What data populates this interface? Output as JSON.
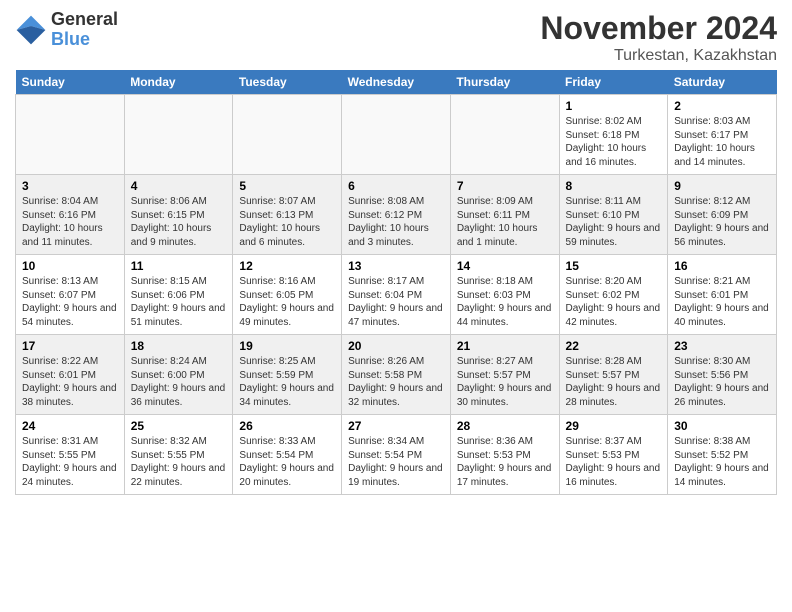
{
  "header": {
    "logo_text_general": "General",
    "logo_text_blue": "Blue",
    "month_title": "November 2024",
    "location": "Turkestan, Kazakhstan"
  },
  "weekdays": [
    "Sunday",
    "Monday",
    "Tuesday",
    "Wednesday",
    "Thursday",
    "Friday",
    "Saturday"
  ],
  "weeks": [
    [
      {
        "day": "",
        "sunrise": "",
        "sunset": "",
        "daylight": ""
      },
      {
        "day": "",
        "sunrise": "",
        "sunset": "",
        "daylight": ""
      },
      {
        "day": "",
        "sunrise": "",
        "sunset": "",
        "daylight": ""
      },
      {
        "day": "",
        "sunrise": "",
        "sunset": "",
        "daylight": ""
      },
      {
        "day": "",
        "sunrise": "",
        "sunset": "",
        "daylight": ""
      },
      {
        "day": "1",
        "sunrise": "Sunrise: 8:02 AM",
        "sunset": "Sunset: 6:18 PM",
        "daylight": "Daylight: 10 hours and 16 minutes."
      },
      {
        "day": "2",
        "sunrise": "Sunrise: 8:03 AM",
        "sunset": "Sunset: 6:17 PM",
        "daylight": "Daylight: 10 hours and 14 minutes."
      }
    ],
    [
      {
        "day": "3",
        "sunrise": "Sunrise: 8:04 AM",
        "sunset": "Sunset: 6:16 PM",
        "daylight": "Daylight: 10 hours and 11 minutes."
      },
      {
        "day": "4",
        "sunrise": "Sunrise: 8:06 AM",
        "sunset": "Sunset: 6:15 PM",
        "daylight": "Daylight: 10 hours and 9 minutes."
      },
      {
        "day": "5",
        "sunrise": "Sunrise: 8:07 AM",
        "sunset": "Sunset: 6:13 PM",
        "daylight": "Daylight: 10 hours and 6 minutes."
      },
      {
        "day": "6",
        "sunrise": "Sunrise: 8:08 AM",
        "sunset": "Sunset: 6:12 PM",
        "daylight": "Daylight: 10 hours and 3 minutes."
      },
      {
        "day": "7",
        "sunrise": "Sunrise: 8:09 AM",
        "sunset": "Sunset: 6:11 PM",
        "daylight": "Daylight: 10 hours and 1 minute."
      },
      {
        "day": "8",
        "sunrise": "Sunrise: 8:11 AM",
        "sunset": "Sunset: 6:10 PM",
        "daylight": "Daylight: 9 hours and 59 minutes."
      },
      {
        "day": "9",
        "sunrise": "Sunrise: 8:12 AM",
        "sunset": "Sunset: 6:09 PM",
        "daylight": "Daylight: 9 hours and 56 minutes."
      }
    ],
    [
      {
        "day": "10",
        "sunrise": "Sunrise: 8:13 AM",
        "sunset": "Sunset: 6:07 PM",
        "daylight": "Daylight: 9 hours and 54 minutes."
      },
      {
        "day": "11",
        "sunrise": "Sunrise: 8:15 AM",
        "sunset": "Sunset: 6:06 PM",
        "daylight": "Daylight: 9 hours and 51 minutes."
      },
      {
        "day": "12",
        "sunrise": "Sunrise: 8:16 AM",
        "sunset": "Sunset: 6:05 PM",
        "daylight": "Daylight: 9 hours and 49 minutes."
      },
      {
        "day": "13",
        "sunrise": "Sunrise: 8:17 AM",
        "sunset": "Sunset: 6:04 PM",
        "daylight": "Daylight: 9 hours and 47 minutes."
      },
      {
        "day": "14",
        "sunrise": "Sunrise: 8:18 AM",
        "sunset": "Sunset: 6:03 PM",
        "daylight": "Daylight: 9 hours and 44 minutes."
      },
      {
        "day": "15",
        "sunrise": "Sunrise: 8:20 AM",
        "sunset": "Sunset: 6:02 PM",
        "daylight": "Daylight: 9 hours and 42 minutes."
      },
      {
        "day": "16",
        "sunrise": "Sunrise: 8:21 AM",
        "sunset": "Sunset: 6:01 PM",
        "daylight": "Daylight: 9 hours and 40 minutes."
      }
    ],
    [
      {
        "day": "17",
        "sunrise": "Sunrise: 8:22 AM",
        "sunset": "Sunset: 6:01 PM",
        "daylight": "Daylight: 9 hours and 38 minutes."
      },
      {
        "day": "18",
        "sunrise": "Sunrise: 8:24 AM",
        "sunset": "Sunset: 6:00 PM",
        "daylight": "Daylight: 9 hours and 36 minutes."
      },
      {
        "day": "19",
        "sunrise": "Sunrise: 8:25 AM",
        "sunset": "Sunset: 5:59 PM",
        "daylight": "Daylight: 9 hours and 34 minutes."
      },
      {
        "day": "20",
        "sunrise": "Sunrise: 8:26 AM",
        "sunset": "Sunset: 5:58 PM",
        "daylight": "Daylight: 9 hours and 32 minutes."
      },
      {
        "day": "21",
        "sunrise": "Sunrise: 8:27 AM",
        "sunset": "Sunset: 5:57 PM",
        "daylight": "Daylight: 9 hours and 30 minutes."
      },
      {
        "day": "22",
        "sunrise": "Sunrise: 8:28 AM",
        "sunset": "Sunset: 5:57 PM",
        "daylight": "Daylight: 9 hours and 28 minutes."
      },
      {
        "day": "23",
        "sunrise": "Sunrise: 8:30 AM",
        "sunset": "Sunset: 5:56 PM",
        "daylight": "Daylight: 9 hours and 26 minutes."
      }
    ],
    [
      {
        "day": "24",
        "sunrise": "Sunrise: 8:31 AM",
        "sunset": "Sunset: 5:55 PM",
        "daylight": "Daylight: 9 hours and 24 minutes."
      },
      {
        "day": "25",
        "sunrise": "Sunrise: 8:32 AM",
        "sunset": "Sunset: 5:55 PM",
        "daylight": "Daylight: 9 hours and 22 minutes."
      },
      {
        "day": "26",
        "sunrise": "Sunrise: 8:33 AM",
        "sunset": "Sunset: 5:54 PM",
        "daylight": "Daylight: 9 hours and 20 minutes."
      },
      {
        "day": "27",
        "sunrise": "Sunrise: 8:34 AM",
        "sunset": "Sunset: 5:54 PM",
        "daylight": "Daylight: 9 hours and 19 minutes."
      },
      {
        "day": "28",
        "sunrise": "Sunrise: 8:36 AM",
        "sunset": "Sunset: 5:53 PM",
        "daylight": "Daylight: 9 hours and 17 minutes."
      },
      {
        "day": "29",
        "sunrise": "Sunrise: 8:37 AM",
        "sunset": "Sunset: 5:53 PM",
        "daylight": "Daylight: 9 hours and 16 minutes."
      },
      {
        "day": "30",
        "sunrise": "Sunrise: 8:38 AM",
        "sunset": "Sunset: 5:52 PM",
        "daylight": "Daylight: 9 hours and 14 minutes."
      }
    ]
  ]
}
